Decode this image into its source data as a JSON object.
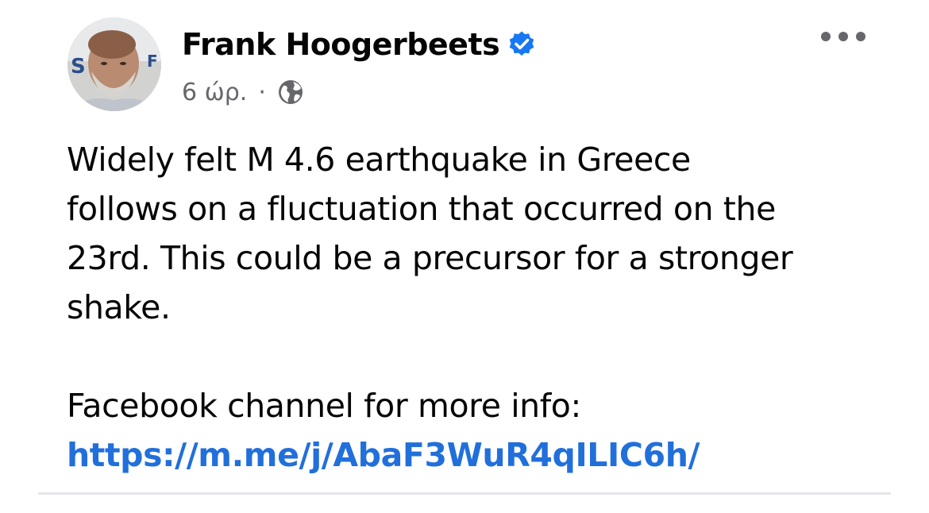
{
  "post": {
    "author_name": "Frank Hoogerbeets",
    "verified": true,
    "time": "6 ώρ.",
    "separator": "·",
    "audience_icon": "globe-icon",
    "more_icon": "more-options-icon",
    "avatar_letters": "S F",
    "body_lines": [
      "Widely felt M 4.6 earthquake in Greece",
      "follows on a fluctuation that occurred on the",
      "23rd. This could be a precursor for a stronger",
      "shake."
    ],
    "info_label": "Facebook channel for more info:",
    "link": "https://m.me/j/AbaF3WuR4qILIC6h/"
  },
  "colors": {
    "link": "#216fdb",
    "verified_badge": "#1877f2",
    "meta_text": "#65676b",
    "divider": "#e4e6ea"
  }
}
